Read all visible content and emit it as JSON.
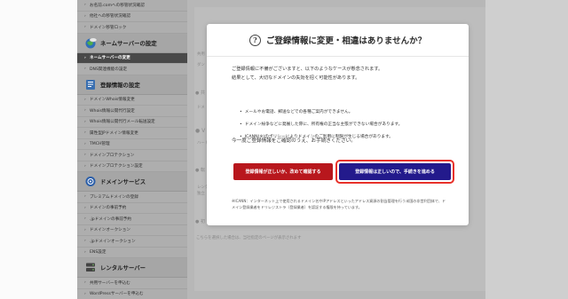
{
  "sidebar": {
    "top_items": [
      {
        "label": "お名前.comへの移管状況確認"
      },
      {
        "label": "他社への移管状況確認"
      },
      {
        "label": "ドメイン移管ロック"
      }
    ],
    "sections": [
      {
        "title": "ネームサーバーの設定",
        "icon": "globe-icon",
        "items": [
          {
            "label": "ネームサーバーの変更",
            "active": true
          },
          {
            "label": "DNS関連機能の設定",
            "active": false
          }
        ]
      },
      {
        "title": "登録情報の設定",
        "icon": "document-icon",
        "items": [
          {
            "label": "ドメインWhois情報変更"
          },
          {
            "label": "Whois情報公開代行設定"
          },
          {
            "label": "Whois情報公開代行メール転送設定"
          },
          {
            "label": "属性型JPドメイン情報変更"
          },
          {
            "label": "TMCH管理"
          },
          {
            "label": "ドメインプロテクション"
          },
          {
            "label": "ドメインプロテクション設定"
          }
        ]
      },
      {
        "title": "ドメインサービス",
        "icon": "domain-service-icon",
        "items": [
          {
            "label": "プレミアムドメインの登録"
          },
          {
            "label": "ドメインの事前予約"
          },
          {
            "label": ".jpドメインの事前予約"
          },
          {
            "label": "ドメインオークション"
          },
          {
            "label": ".jpドメインオークション"
          },
          {
            "label": "ENS設定"
          }
        ]
      },
      {
        "title": "レンタルサーバー",
        "icon": "server-icon",
        "items": [
          {
            "label": "共用サーバーを申込む"
          },
          {
            "label": "WordPressサーバーを申込む"
          }
        ]
      }
    ]
  },
  "background": {
    "snippets": [
      "共用",
      "ダン",
      "共",
      "ドメ",
      "V",
      "ハード",
      "転",
      "レンタ",
      "独立",
      "初",
      "こちらを選択した場合は、当社指定のページが表示されます"
    ]
  },
  "modal": {
    "title": "ご登録情報に変更・相違はありませんか？",
    "intro_lines": [
      "ご登録情報に不備がございますと、以下のようなケースが懸念されます。",
      "結果として、大切なドメインの失効を招く可能性があります。"
    ],
    "bullets": [
      "メールやお電話、郵送などでの各種ご案内ができません。",
      "ドメイン紛争などに発展した際に、所有権の正当な主張ができない場合があります。",
      "ICANN(※)のポリシーによりドメインのご利用に制限が生じる場合があります。"
    ],
    "confirm_text": "今一度ご登録情報をご確認のうえ、お手続きください。",
    "button_secondary": "登録情報が正しいか、改めて確認する",
    "button_primary": "登録情報は正しいので、手続きを進める",
    "footnote": "※ICANN：インターネット上で使用されるドメイン名やIPアドレスといったアドレス資源の割当管理を行う米国の非営利団体で、ドメイン登録業者をドリレジストラ（登録業者）を認証する権限を持っています。"
  },
  "colors": {
    "sidebar_bg": "#aeaeae",
    "active_item": "#494949",
    "secondary_button": "#b8171d",
    "primary_button": "#231a8c",
    "highlight_border": "#e8312a"
  }
}
